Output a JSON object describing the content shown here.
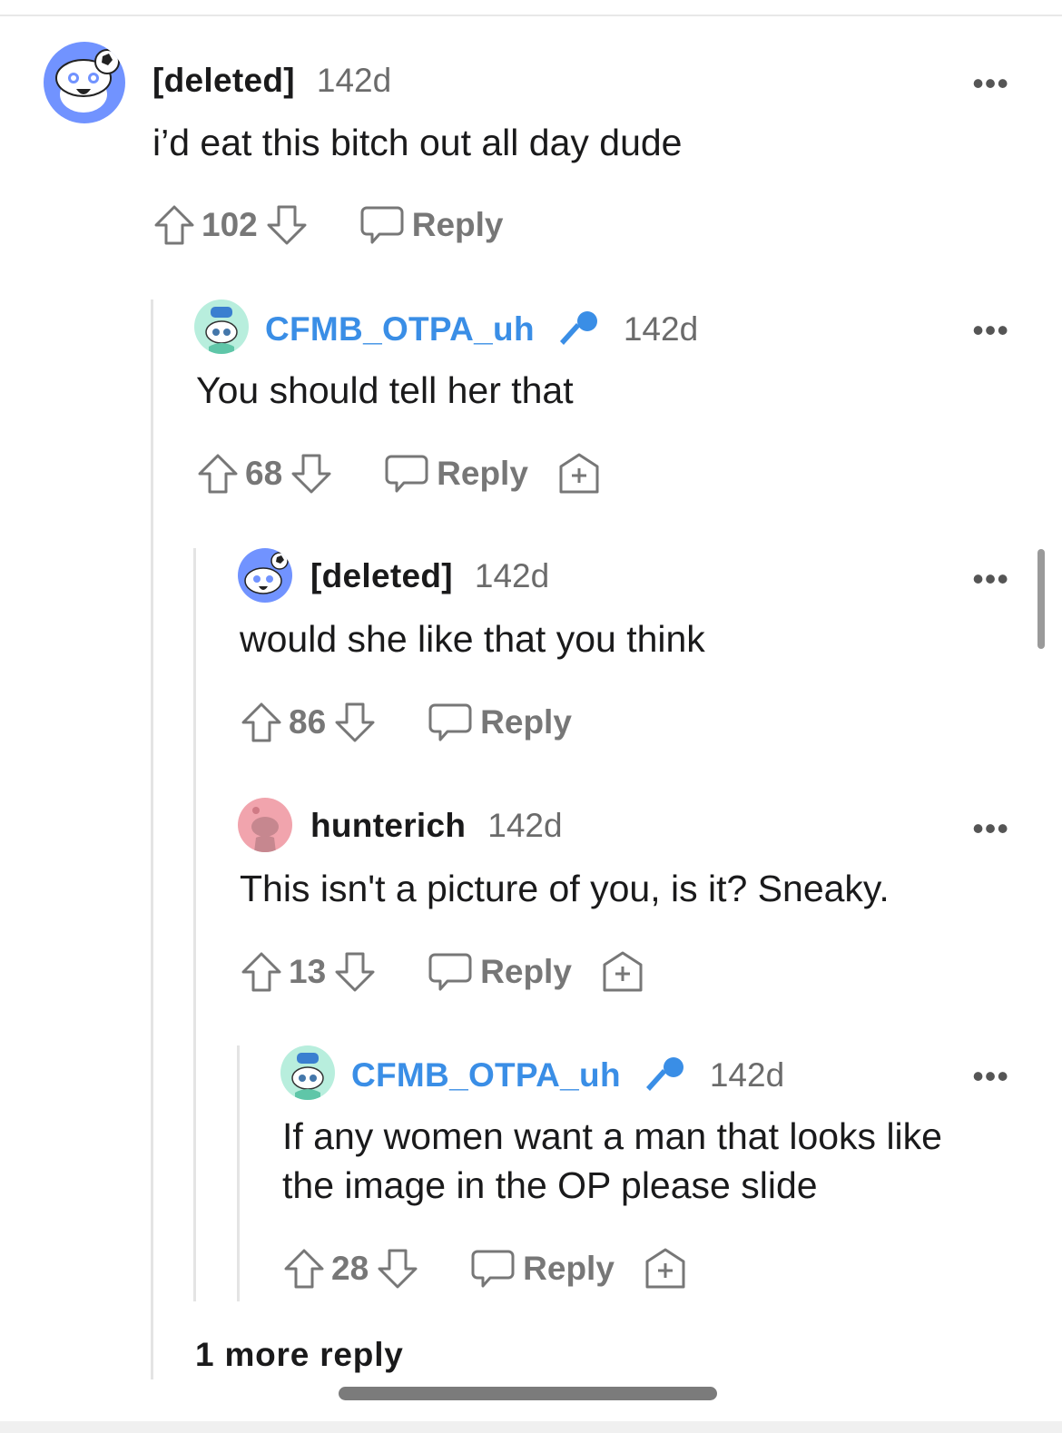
{
  "comments": [
    {
      "username": "[deleted]",
      "age": "142d",
      "body": "i’d eat this bitch out all day dude",
      "votes": "102",
      "reply_label": "Reply"
    },
    {
      "username": "CFMB_OTPA_uh",
      "age": "142d",
      "body": "You should tell her that",
      "votes": "68",
      "reply_label": "Reply"
    },
    {
      "username": "[deleted]",
      "age": "142d",
      "body": "would she like that you think",
      "votes": "86",
      "reply_label": "Reply"
    },
    {
      "username": "hunterich",
      "age": "142d",
      "body": "This isn't a picture of you, is it? Sneaky.",
      "votes": "13",
      "reply_label": "Reply"
    },
    {
      "username": "CFMB_OTPA_uh",
      "age": "142d",
      "body_line1": "If any women want a man that looks like",
      "body_line2": "the image in the OP please slide",
      "votes": "28",
      "reply_label": "Reply"
    }
  ],
  "more_replies": "1 more reply",
  "more_menu": "•••",
  "icons": {
    "upvote": "arrow-up-icon",
    "downvote": "arrow-down-icon",
    "reply": "speech-bubble-icon",
    "award": "award-plus-icon",
    "mod": "microphone-icon",
    "avatar": "snoo-avatar-icon"
  },
  "colors": {
    "username_op": "#3a8ee6",
    "meta": "#6b6b6b",
    "actions": "#777777"
  }
}
